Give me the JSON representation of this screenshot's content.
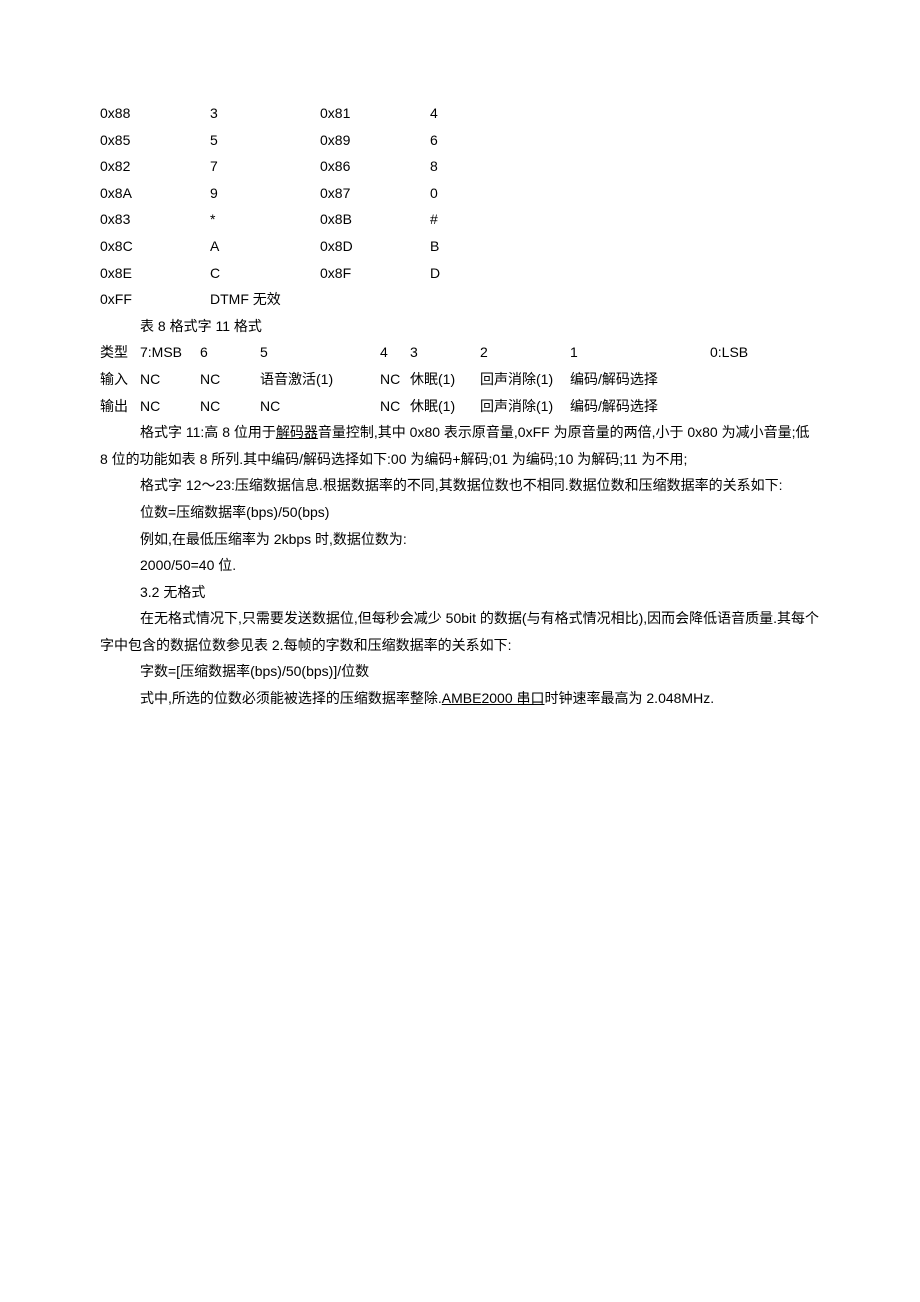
{
  "dtmf_table": {
    "rows": [
      {
        "a": "0x88",
        "b": "3",
        "c": "0x81",
        "d": "4"
      },
      {
        "a": "0x85",
        "b": "5",
        "c": "0x89",
        "d": "6"
      },
      {
        "a": "0x82",
        "b": "7",
        "c": "0x86",
        "d": "8"
      },
      {
        "a": "0x8A",
        "b": "9",
        "c": "0x87",
        "d": "0"
      },
      {
        "a": "0x83",
        "b": "*",
        "c": "0x8B",
        "d": "#"
      },
      {
        "a": "0x8C",
        "b": "A",
        "c": "0x8D",
        "d": "B"
      },
      {
        "a": "0x8E",
        "b": "C",
        "c": "0x8F",
        "d": "D"
      }
    ],
    "invalid_row": {
      "a": "0xFF",
      "b": "DTMF 无效"
    }
  },
  "table8_caption": "表 8  格式字 11 格式",
  "header_row": {
    "h1": "类型",
    "h2": "7:MSB",
    "h3": "6",
    "h4": "5",
    "h5": "4",
    "h6": "3",
    "h7": "2",
    "h8": "1",
    "h9": "0:LSB"
  },
  "input_row": {
    "h1": "输入",
    "h2": "NC",
    "h3": "NC",
    "h4": "语音激活(1)",
    "h5": "NC",
    "h6": "休眠(1)",
    "h7": "回声消除(1)",
    "h8": "编码/解码选择",
    "h9": ""
  },
  "output_row": {
    "h1": "输出",
    "h2": "NC",
    "h3": "NC",
    "h4": "NC",
    "h5": "NC",
    "h6": "休眠(1)",
    "h7": "回声消除(1)",
    "h8": "编码/解码选择",
    "h9": ""
  },
  "paragraphs": {
    "p1a": "格式字 11:高 8 位用于",
    "p1_link1": "解码器",
    "p1b": "音量控制,其中 0x80 表示原音量,0xFF 为原音量的两倍,小于 0x80 为减小音量;低 8 位的功能如表 8 所列.其中编码/解码选择如下:00 为编码+解码;01 为编码;10 为解码;11 为不用;",
    "p2": "格式字 12～23:压缩数据信息.根据数据率的不同,其数据位数也不相同.数据位数和压缩数据率的关系如下:",
    "p3": "位数=压缩数据率(bps)/50(bps)",
    "p4": "例如,在最低压缩率为 2kbps 时,数据位数为:",
    "p5": "2000/50=40 位.",
    "p6": "3.2  无格式",
    "p7": "在无格式情况下,只需要发送数据位,但每秒会减少 50bit 的数据(与有格式情况相比),因而会降低语音质量.其每个字中包含的数据位数参见表 2.每帧的字数和压缩数据率的关系如下:",
    "p8": "字数=[压缩数据率(bps)/50(bps)]/位数",
    "p9a": "式中,所选的位数必须能被选择的压缩数据率整除.",
    "p9_link": "AMBE2000 串口",
    "p9b": "时钟速率最高为 2.048MHz."
  }
}
